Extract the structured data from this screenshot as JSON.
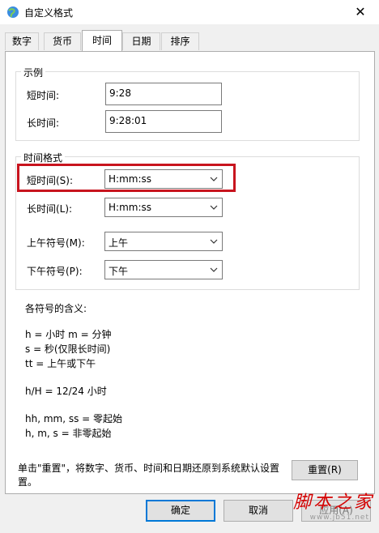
{
  "window": {
    "title": "自定义格式",
    "close_glyph": "✕"
  },
  "tabs": [
    {
      "label": "数字",
      "active": false
    },
    {
      "label": "货币",
      "active": false
    },
    {
      "label": "时间",
      "active": true
    },
    {
      "label": "日期",
      "active": false
    },
    {
      "label": "排序",
      "active": false
    }
  ],
  "example": {
    "legend": "示例",
    "short_label": "短时间:",
    "short_value": "9:28",
    "long_label": "长时间:",
    "long_value": "9:28:01"
  },
  "format": {
    "legend": "时间格式",
    "short_label": "短时间(S):",
    "short_value": "H:mm:ss",
    "long_label": "长时间(L):",
    "long_value": "H:mm:ss",
    "am_label": "上午符号(M):",
    "am_value": "上午",
    "pm_label": "下午符号(P):",
    "pm_value": "下午"
  },
  "info": {
    "heading": "各符号的含义:",
    "line1": "h = 小时   m = 分钟",
    "line2": "s = 秒(仅限长时间)",
    "line3": "tt = 上午或下午",
    "line4": "h/H = 12/24 小时",
    "line5": "hh, mm, ss = 零起始",
    "line6": "h, m, s = 非零起始"
  },
  "reset": {
    "text_line1": "单击\"重置\"，将数字、货币、时间和日期还原到系统默认设置",
    "text_line2": "置。",
    "button": "重置(R)"
  },
  "buttons": {
    "ok": "确定",
    "cancel": "取消",
    "apply": "应用(A)"
  },
  "watermark": {
    "text": "脚本之家",
    "url": "www.jb51.net"
  },
  "colors": {
    "highlight": "#c8141e",
    "focus": "#0078d7"
  }
}
